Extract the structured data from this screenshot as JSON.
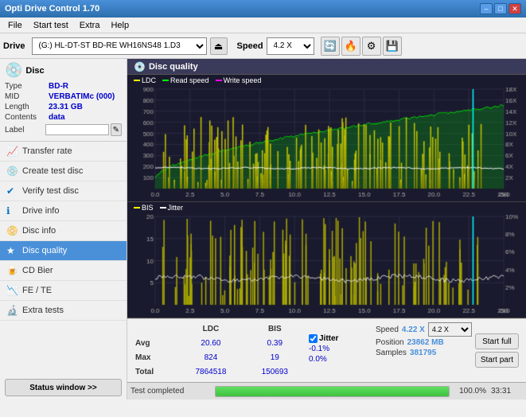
{
  "app": {
    "title": "Opti Drive Control 1.70",
    "minimize": "–",
    "maximize": "□",
    "close": "✕"
  },
  "menu": {
    "items": [
      "File",
      "Start test",
      "Extra",
      "Help"
    ]
  },
  "drive_bar": {
    "label": "Drive",
    "drive_value": "(G:)  HL-DT-ST BD-RE  WH16NS48 1.D3",
    "speed_label": "Speed",
    "speed_value": "4.2 X"
  },
  "disc_panel": {
    "header": "Disc",
    "type_label": "Type",
    "type_value": "BD-R",
    "mid_label": "MID",
    "mid_value": "VERBATIMc (000)",
    "length_label": "Length",
    "length_value": "23.31 GB",
    "contents_label": "Contents",
    "contents_value": "data",
    "label_label": "Label",
    "label_value": ""
  },
  "sidebar": {
    "items": [
      {
        "id": "transfer-rate",
        "label": "Transfer rate",
        "icon": "📈"
      },
      {
        "id": "create-test",
        "label": "Create test disc",
        "icon": "💿"
      },
      {
        "id": "verify-disc",
        "label": "Verify test disc",
        "icon": "✔"
      },
      {
        "id": "drive-info",
        "label": "Drive info",
        "icon": "ℹ"
      },
      {
        "id": "disc-info",
        "label": "Disc info",
        "icon": "📀"
      },
      {
        "id": "disc-quality",
        "label": "Disc quality",
        "icon": "★",
        "active": true
      },
      {
        "id": "cd-bier",
        "label": "CD Bier",
        "icon": "🍺"
      },
      {
        "id": "fe-te",
        "label": "FE / TE",
        "icon": "📉"
      },
      {
        "id": "extra-tests",
        "label": "Extra tests",
        "icon": "🔬"
      }
    ]
  },
  "status_btn": "Status window >>",
  "content": {
    "header": "Disc quality",
    "chart1": {
      "legend": [
        {
          "label": "LDC",
          "color": "#ffff00"
        },
        {
          "label": "Read speed",
          "color": "#00ff00"
        },
        {
          "label": "Write speed",
          "color": "#ff00ff"
        }
      ],
      "y_max": 900,
      "y_right_max": 18,
      "x_max": 25
    },
    "chart2": {
      "legend": [
        {
          "label": "BIS",
          "color": "#ffff00"
        },
        {
          "label": "Jitter",
          "color": "#ffffff"
        }
      ],
      "y_max": 20,
      "y_right_max": 10,
      "x_max": 25
    }
  },
  "stats": {
    "col_headers": [
      "LDC",
      "BIS"
    ],
    "rows": [
      {
        "label": "Avg",
        "ldc": "20.60",
        "bis": "0.39"
      },
      {
        "label": "Max",
        "ldc": "824",
        "bis": "19"
      },
      {
        "label": "Total",
        "ldc": "7864518",
        "bis": "150693"
      }
    ],
    "jitter_checked": true,
    "jitter_label": "Jitter",
    "jitter_avg": "-0.1%",
    "jitter_max": "0.0%",
    "jitter_total": "",
    "speed_label": "Speed",
    "speed_value": "4.22 X",
    "speed_select": "4.2 X",
    "position_label": "Position",
    "position_value": "23862 MB",
    "samples_label": "Samples",
    "samples_value": "381795",
    "btn_start_full": "Start full",
    "btn_start_part": "Start part"
  },
  "progress": {
    "status": "Test completed",
    "percent": "100.0%",
    "fill_width": 100,
    "time": "33:31"
  }
}
